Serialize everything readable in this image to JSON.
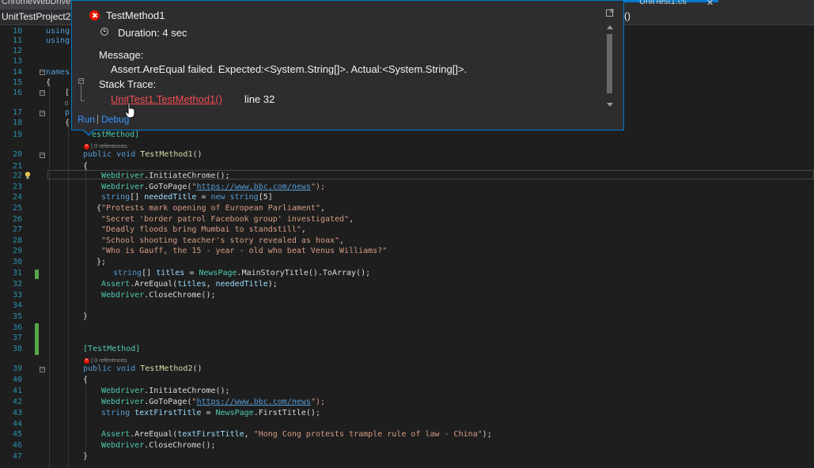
{
  "tabs": {
    "left_tab": "ChromeWebDriver",
    "right_tab": "UnitTest1.cs",
    "right_close": "✕"
  },
  "navbar": {
    "project": "UnitTestProject2",
    "member_fragment": "()"
  },
  "popup": {
    "title": "TestMethod1",
    "duration": "Duration: 4 sec",
    "message_label": "Message:",
    "message": "Assert.AreEqual failed. Expected:<System.String[]>. Actual:<System.String[]>.",
    "stack_label": "Stack Trace:",
    "stack_link": "UnitTest1.TestMethod1()",
    "stack_line": "line 32",
    "run": "Run",
    "debug": "Debug",
    "tree_toggle": "−",
    "icons": [
      "failed-test-icon",
      "clock-icon",
      "expand-icon",
      "hand-cursor-icon"
    ],
    "colors": {
      "fail": "#e51400",
      "border": "#007acc",
      "link": "#f14c4c"
    }
  },
  "gutter": {
    "line_numbers": [
      "10",
      "11",
      "12",
      "13",
      "14",
      "15",
      "16",
      "",
      "17",
      "18",
      "19",
      "",
      "20",
      "21",
      "22",
      "23",
      "24",
      "25",
      "26",
      "27",
      "28",
      "29",
      "30",
      "31",
      "32",
      "33",
      "34",
      "35",
      "36",
      "37",
      "38",
      "",
      "39",
      "40",
      "41",
      "42",
      "43",
      "44",
      "45",
      "46",
      "47"
    ]
  },
  "code": {
    "l10": "using",
    "l11": "using",
    "l14": "names",
    "l15": "{",
    "l16": "[",
    "l16b": "0",
    "l17": "p",
    "l18": "{",
    "l19_attr": "estMethod]",
    "lens_refs": "0 references",
    "l20_kw": "public void ",
    "l20_name": "TestMethod1",
    "l20_tail": "()",
    "l21": "{",
    "l22_ty": "Webdriver",
    "l22_rest": ".InitiateChrome();",
    "l23_ty": "Webdriver",
    "l23_m": ".GoToPage(",
    "l23_q1": "\"",
    "l23_url": "https://www.bbc.com/news",
    "l23_q2": "\");",
    "l24_kw": "string",
    "l24_a": "[] ",
    "l24_id": "neededTitle",
    "l24_b": " = ",
    "l24_kw2": "new string",
    "l24_c": "[5]",
    "l25_brace": "{",
    "l25_s": "\"Protests mark opening of European Parliament\"",
    "l25_c": ",",
    "l26_s": "\"Secret 'border patrol Facebook group' investigated\"",
    "l26_c": ",",
    "l27_s": "\"Deadly floods bring Mumbai to standstill\"",
    "l27_c": ",",
    "l28_s": "\"School shooting teacher's story revealed as hoax\"",
    "l28_c": ",",
    "l29_s": "\"Who is Gauff, the 15 - year - old who beat Venus Williams?\"",
    "l30": "};",
    "l31_kw": "string",
    "l31_a": "[] ",
    "l31_id": "titles",
    "l31_b": " = ",
    "l31_ty": "NewsPage",
    "l31_rest": ".MainStoryTitle().ToArray();",
    "l32_ty": "Assert",
    "l32_a": ".AreEqual(",
    "l32_id1": "titles",
    "l32_b": ", ",
    "l32_id2": "neededTitle",
    "l32_c": ");",
    "l33_ty": "Webdriver",
    "l33_rest": ".CloseChrome();",
    "l35": "}",
    "l38_attr": "[TestMethod]",
    "l39_kw": "public void ",
    "l39_name": "TestMethod2",
    "l39_tail": "()",
    "l40": "{",
    "l41_ty": "Webdriver",
    "l41_rest": ".InitiateChrome();",
    "l42_ty": "Webdriver",
    "l42_m": ".GoToPage(",
    "l42_q1": "\"",
    "l42_url": "https://www.bbc.com/news",
    "l42_q2": "\");",
    "l43_kw": "string",
    "l43_a": " ",
    "l43_id": "textFirstTitle",
    "l43_b": " = ",
    "l43_ty": "NewsPage",
    "l43_rest": ".FirstTitle();",
    "l45_ty": "Assert",
    "l45_a": ".AreEqual(",
    "l45_id": "textFirstTitle",
    "l45_b": ", ",
    "l45_s": "\"Hong Cong protests trample rule of law - China\"",
    "l45_c": ");",
    "l46_ty": "Webdriver",
    "l46_rest": ".CloseChrome();",
    "l47": "}"
  }
}
